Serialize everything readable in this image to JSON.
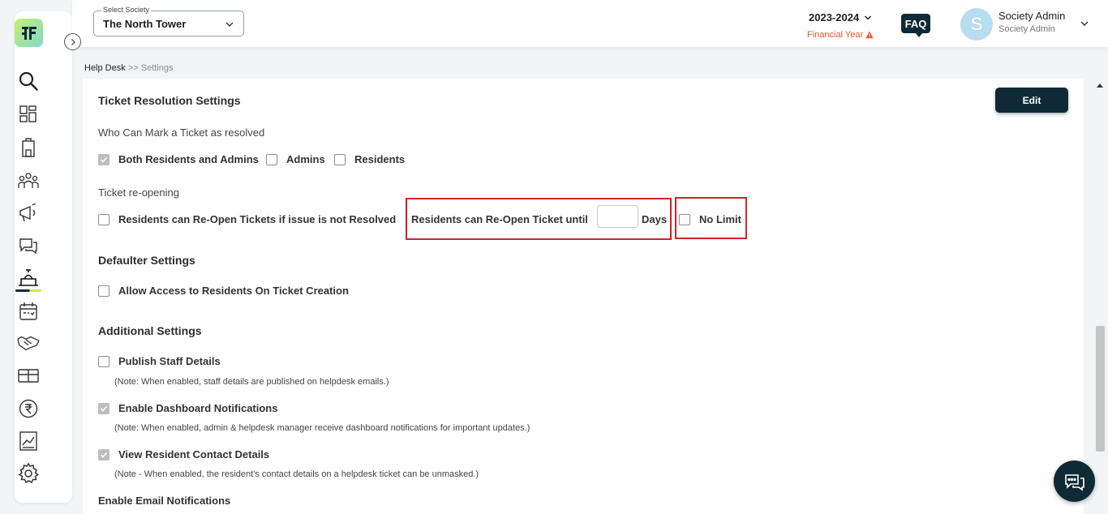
{
  "header": {
    "society_label": "Select Society",
    "society_value": "The North Tower",
    "year": "2023-2024",
    "financial_year_label": "Financial Year",
    "faq_label": "FAQ",
    "avatar_initial": "S",
    "user_name": "Society Admin",
    "user_role": "Society Admin"
  },
  "breadcrumb": {
    "root": "Help Desk",
    "separator": ">>",
    "current": "Settings"
  },
  "edit_label": "Edit",
  "ticket_resolution": {
    "title": "Ticket Resolution Settings",
    "who_label": "Who Can Mark a Ticket as resolved",
    "options": [
      {
        "label": "Both Residents and Admins",
        "checked": true
      },
      {
        "label": "Admins",
        "checked": false
      },
      {
        "label": "Residents",
        "checked": false
      }
    ],
    "reopen_label": "Ticket re-opening",
    "reopen_option": {
      "label": "Residents can Re-Open Tickets if issue is not Resolved",
      "checked": false
    },
    "reopen_until_label": "Residents can Re-Open Ticket until",
    "days_value": "",
    "days_label": "Days",
    "no_limit": {
      "label": "No Limit",
      "checked": false
    }
  },
  "defaulter": {
    "title": "Defaulter Settings",
    "option": {
      "label": "Allow Access to Residents On Ticket Creation",
      "checked": false
    }
  },
  "additional": {
    "title": "Additional Settings",
    "items": [
      {
        "label": "Publish Staff Details",
        "checked": false,
        "note": "(Note: When enabled, staff details are published on helpdesk emails.)"
      },
      {
        "label": "Enable Dashboard Notifications",
        "checked": true,
        "note": "(Note: When enabled, admin & helpdesk manager receive dashboard notifications for important updates.)"
      },
      {
        "label": "View Resident Contact Details",
        "checked": true,
        "note": "(Note - When enabled, the resident's contact details on a helpdesk ticket can be unmasked.)"
      }
    ]
  },
  "email_notifications_title": "Enable Email Notifications",
  "colors": {
    "brand_dark": "#0f2a35",
    "warning": "#e4572e",
    "highlight_border": "#d3202b"
  },
  "sidebar_icons": [
    "search-icon",
    "dashboard-icon",
    "building-icon",
    "users-icon",
    "megaphone-icon",
    "chat-icon",
    "helpdesk-icon",
    "calendar-icon",
    "handshake-icon",
    "gift-icon",
    "rupee-icon",
    "chart-icon",
    "gear-icon"
  ]
}
